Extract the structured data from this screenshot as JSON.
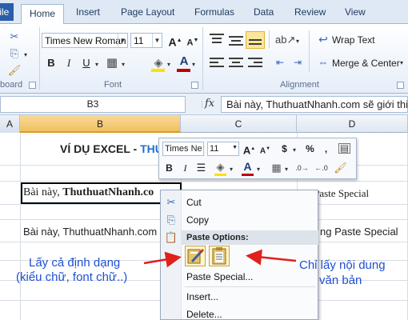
{
  "tabs": [
    {
      "label": "File",
      "active": false
    },
    {
      "label": "Home",
      "active": true
    },
    {
      "label": "Insert",
      "active": false
    },
    {
      "label": "Page Layout",
      "active": false
    },
    {
      "label": "Formulas",
      "active": false
    },
    {
      "label": "Data",
      "active": false
    },
    {
      "label": "Review",
      "active": false
    },
    {
      "label": "View",
      "active": false
    }
  ],
  "ribbon": {
    "clipboard_label": "board",
    "font_group_label": "Font",
    "alignment_group_label": "Alignment",
    "font_name": "Times New Roman",
    "font_size": "11",
    "bold": "B",
    "italic": "I",
    "underline": "U",
    "wrap_text": "Wrap Text",
    "merge_center": "Merge & Center",
    "grow_font": "A",
    "shrink_font": "A",
    "font_color_letter": "A"
  },
  "formula_bar": {
    "name_box": "B3",
    "fx": "fx",
    "formula": "Bài này, ThuthuatNhanh.com sẽ giới thiệu"
  },
  "grid": {
    "columns": [
      "A",
      "B",
      "C",
      "D"
    ],
    "selected_column": "B",
    "title_cell_prefix": "VÍ DỤ EXCEL - ",
    "title_cell_highlight": "THUT",
    "b3_text_plain": "Bài này, ",
    "b3_text_bold": "ThuthuatNhanh.co",
    "b3_tail": "giới thiệu tới bạn cách sử dụng Paste Special",
    "b5_text": "Bài này, ThuthuatNhanh.com",
    "b5_tail": "ng Paste Special",
    "highlight_color": "#1e6fd9"
  },
  "mini_toolbar": {
    "font_name": "Times Ne",
    "font_size": "11",
    "grow_font": "A",
    "shrink_font": "A",
    "currency": "$",
    "percent": "%",
    "comma": ",",
    "bold": "B",
    "italic": "I",
    "font_color_letter": "A"
  },
  "context_menu": {
    "cut": "Cut",
    "copy": "Copy",
    "paste_options_header": "Paste Options:",
    "paste_special": "Paste Special...",
    "insert": "Insert...",
    "delete": "Delete..."
  },
  "annotations": {
    "left_line1": "Lấy cả định dạng",
    "left_line2": "(kiểu chữ, font chữ..)",
    "right_line1": "Chỉ lấy nội dung",
    "right_line2": "văn bản"
  },
  "colors": {
    "annotation": "#1f4fd1",
    "arrow": "#e0201b",
    "font_color_bar": "#c00000",
    "fill_color_bar": "#ffe000"
  }
}
